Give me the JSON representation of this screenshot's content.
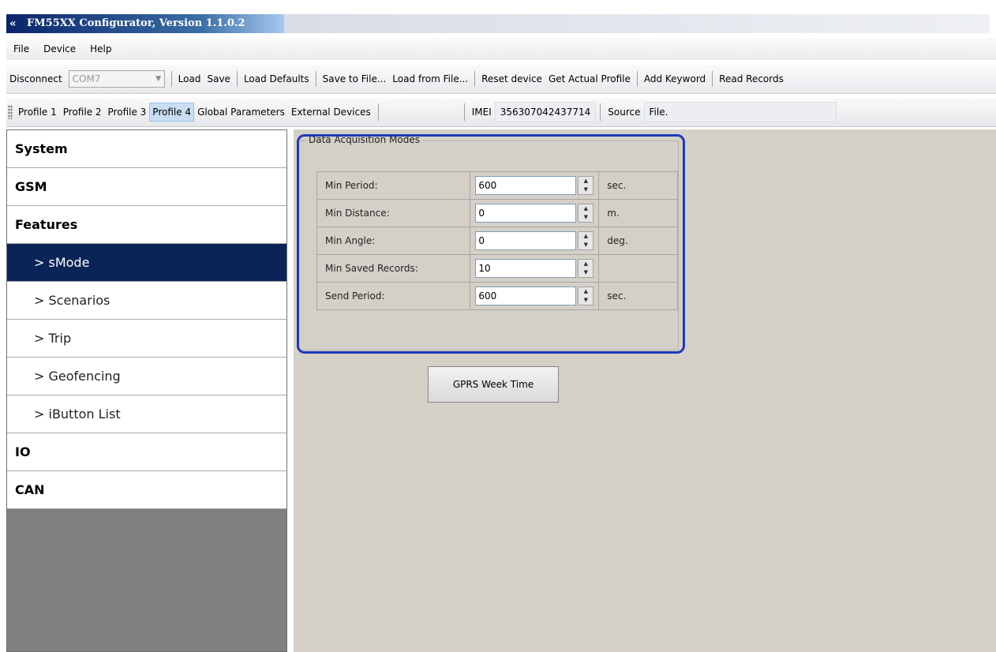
{
  "window": {
    "title": "FM55XX Configurator, Version 1.1.0.2",
    "icon": "app-logo-icon"
  },
  "menu": [
    "File",
    "Device",
    "Help"
  ],
  "toolbar": {
    "disconnect": "Disconnect",
    "port": "COM7",
    "load": "Load",
    "save": "Save",
    "load_defaults": "Load Defaults",
    "save_to_file": "Save to File...",
    "load_from_file": "Load from File...",
    "reset_device": "Reset device",
    "get_actual_profile": "Get Actual Profile",
    "add_keyword": "Add Keyword",
    "read_records": "Read Records"
  },
  "tabs": [
    "Profile 1",
    "Profile 2",
    "Profile 3",
    "Profile 4",
    "Global Parameters",
    "External Devices"
  ],
  "active_tab": "Profile 4",
  "imei": {
    "label": "IMEI",
    "value": "356307042437714"
  },
  "source": {
    "label": "Source",
    "value": "File."
  },
  "sidebar": [
    {
      "label": "System"
    },
    {
      "label": "GSM"
    },
    {
      "label": "Features"
    },
    {
      "label": "> sMode"
    },
    {
      "label": "> Scenarios"
    },
    {
      "label": "> Trip"
    },
    {
      "label": "> Geofencing"
    },
    {
      "label": "> iButton List"
    },
    {
      "label": "IO"
    },
    {
      "label": "CAN"
    }
  ],
  "selected_sidebar_item": "> sMode",
  "group": {
    "title": "Data Acquisition Modes",
    "rows": [
      {
        "label": "Min Period:",
        "value": "600",
        "unit": "sec."
      },
      {
        "label": "Min Distance:",
        "value": "0",
        "unit": "m."
      },
      {
        "label": "Min Angle:",
        "value": "0",
        "unit": "deg."
      },
      {
        "label": "Min Saved Records:",
        "value": "10",
        "unit": ""
      },
      {
        "label": "Send Period:",
        "value": "600",
        "unit": "sec."
      }
    ]
  },
  "gprs_button": "GPRS Week Time",
  "colors": {
    "highlight": "#1f3ab8",
    "selected_item": "#0a2458",
    "sidebar_bg": "#808080",
    "panel_bg": "#d4d0c8"
  }
}
